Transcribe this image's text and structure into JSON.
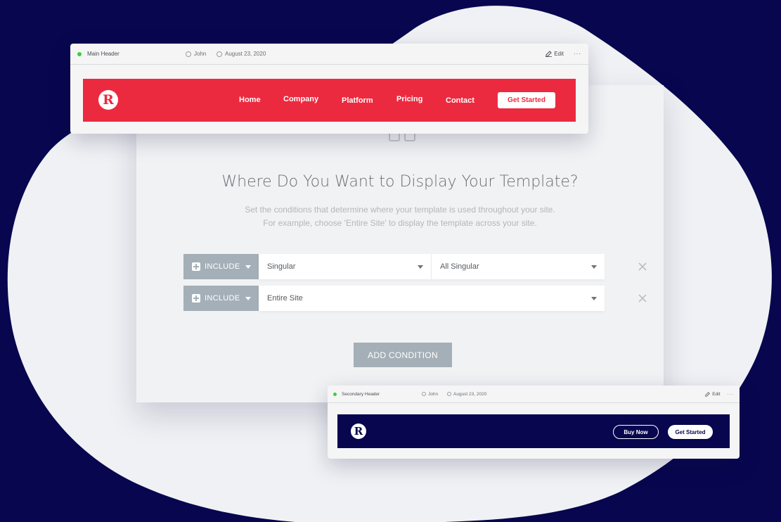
{
  "colors": {
    "background": "#07064f",
    "blob": "#f0f1f4",
    "brand_red": "#ec2a3f",
    "brand_navy": "#07064f",
    "status_green": "#39d040",
    "button_grey": "#a4afb7"
  },
  "main_header_card": {
    "title": "Main Header",
    "author": "John",
    "date": "August 23, 2020",
    "edit_label": "Edit",
    "more_label": "···",
    "logo_letter": "R",
    "nav": [
      "Home",
      "Company",
      "Platform",
      "Pricing",
      "Contact"
    ],
    "cta_label": "Get Started"
  },
  "conditions": {
    "title": "Where Do You Want to Display Your Template?",
    "subtitle_line1": "Set the conditions that determine where your template is used throughout your site.",
    "subtitle_line2": "For example, choose 'Entire Site' to display the template across your site.",
    "rows": [
      {
        "include_label": "INCLUDE",
        "select1": "Singular",
        "select2": "All Singular"
      },
      {
        "include_label": "INCLUDE",
        "select1": "Entire Site"
      }
    ],
    "add_button_label": "ADD CONDITION"
  },
  "secondary_header_card": {
    "title": "Secondary Header",
    "author": "John",
    "date": "August 23, 2020",
    "edit_label": "Edit",
    "more_label": "···",
    "logo_letter": "R",
    "buy_now_label": "Buy Now",
    "cta_label": "Get Started"
  }
}
